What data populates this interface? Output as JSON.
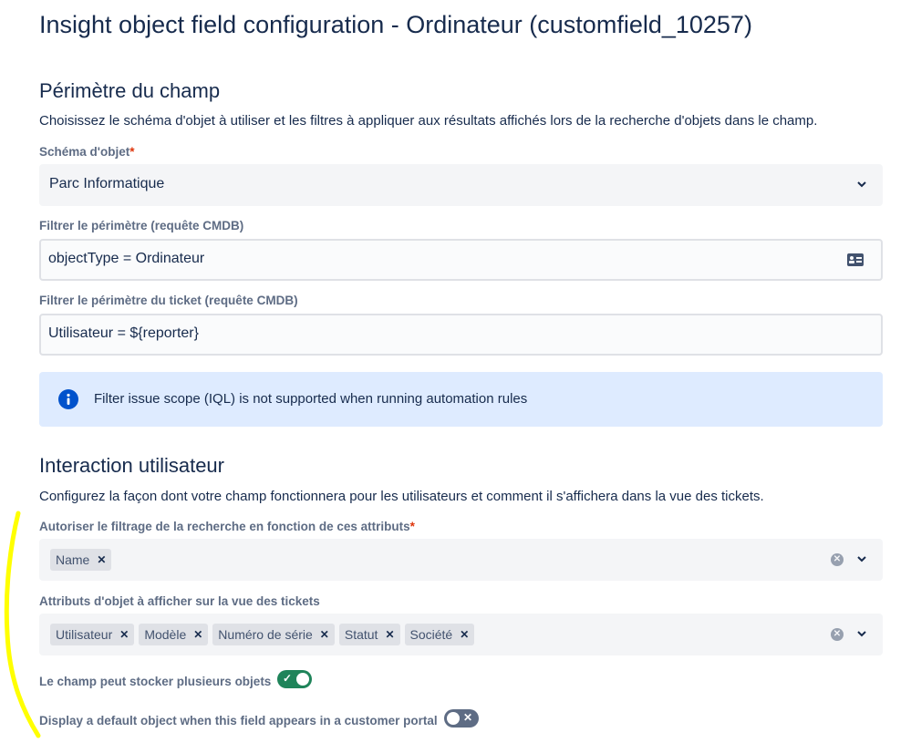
{
  "page": {
    "title": "Insight object field configuration - Ordinateur (customfield_10257)"
  },
  "scope": {
    "heading": "Périmètre du champ",
    "description": "Choisissez le schéma d'objet à utiliser et les filtres à appliquer aux résultats affichés lors de la recherche d'objets dans le champ.",
    "schema_label": "Schéma d'objet",
    "required_mark": "*",
    "schema_value": "Parc Informatique",
    "filter_label": "Filtrer le périmètre (requête CMDB)",
    "filter_value": "objectType = Ordinateur",
    "ticket_filter_label": "Filtrer le périmètre du ticket (requête CMDB)",
    "ticket_filter_value": "Utilisateur = ${reporter}",
    "info_text": "Filter issue scope (IQL) is not supported when running automation rules"
  },
  "interaction": {
    "heading": "Interaction utilisateur",
    "description": "Configurez la façon dont votre champ fonctionnera pour les utilisateurs et comment il s'affichera dans la vue des tickets.",
    "search_attr_label": "Autoriser le filtrage de la recherche en fonction de ces attributs",
    "required_mark": "*",
    "search_tags": [
      "Name"
    ],
    "display_attr_label": "Attributs d'objet à afficher sur la vue des tickets",
    "display_tags": [
      "Utilisateur",
      "Modèle",
      "Numéro de série",
      "Statut",
      "Société"
    ],
    "multi_label": "Le champ peut stocker plusieurs objets",
    "multi_enabled": true,
    "default_label": "Display a default object when this field appears in a customer portal",
    "default_enabled": false
  },
  "colors": {
    "info_bg": "#deebff",
    "info_icon": "#0052cc",
    "toggle_on": "#1f845a",
    "toggle_off": "#5e6c84",
    "required": "#de350b",
    "annotation": "#ffff00"
  },
  "icons": {
    "chevron": "chevron-down-icon",
    "query": "query-editor-icon",
    "info": "info-icon",
    "clear": "clear-icon",
    "remove": "remove-tag-icon",
    "check": "check-icon",
    "cross": "cross-icon"
  }
}
